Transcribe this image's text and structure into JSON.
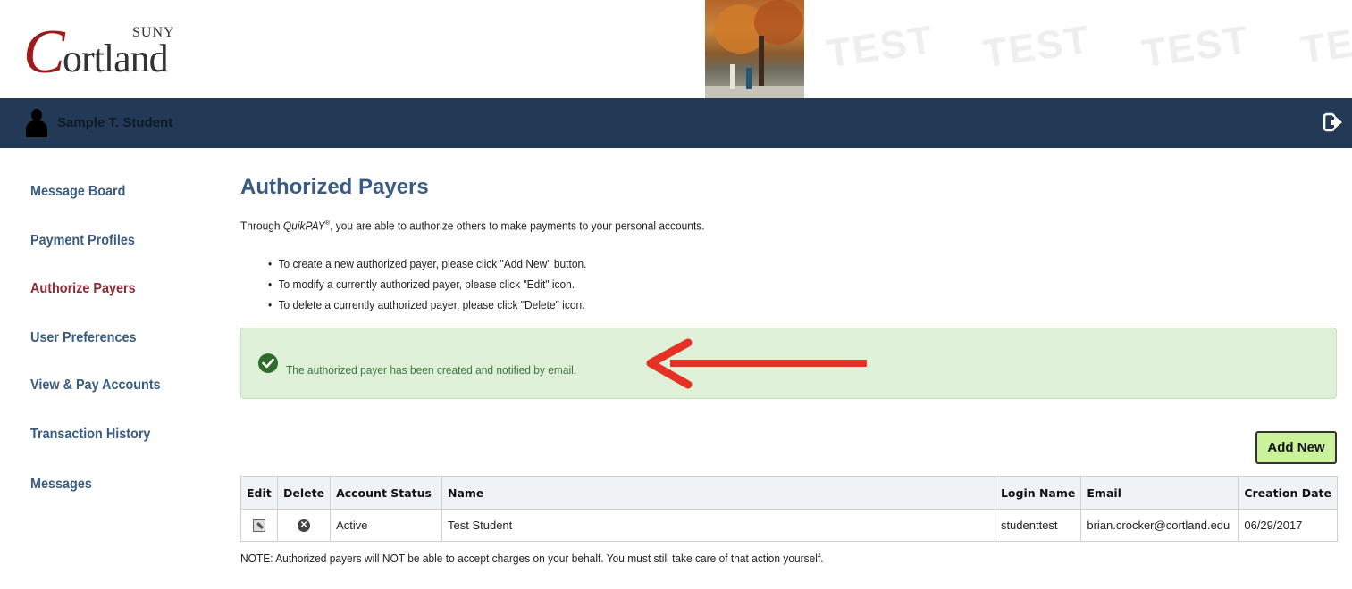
{
  "header": {
    "logo_suny": "SUNY",
    "logo_c": "C",
    "logo_ortland": "ortland",
    "watermarks": [
      "TEST",
      "TEST",
      "TEST",
      "TE"
    ]
  },
  "navbar": {
    "user_name": "Sample T. Student",
    "logout_icon": "sign-out-icon"
  },
  "sidebar": {
    "items": [
      {
        "label": "Message Board"
      },
      {
        "label": "Payment Profiles"
      },
      {
        "label": "Authorize Payers",
        "active": true
      },
      {
        "label": "User Preferences"
      },
      {
        "label": "View & Pay Accounts"
      },
      {
        "label": "Transaction History"
      },
      {
        "label": "Messages"
      }
    ]
  },
  "main": {
    "title": "Authorized Payers",
    "intro_before": "Through ",
    "intro_brand": "QuikPAY",
    "intro_mark": "®",
    "intro_after": ", you are able to authorize others to make payments to your personal accounts.",
    "bullets": [
      "To create a new authorized payer, please click \"Add New\" button.",
      "To modify a currently authorized payer, please click \"Edit\" icon.",
      "To delete a currently authorized payer, please click \"Delete\" icon."
    ],
    "alert_message": "The authorized payer has been created and notified by email.",
    "add_new_label": "Add New",
    "table": {
      "headers": [
        "Edit",
        "Delete",
        "Account Status",
        "Name",
        "Login Name",
        "Email",
        "Creation Date"
      ],
      "rows": [
        {
          "status": "Active",
          "name": "Test Student",
          "login": "studenttest",
          "email": "brian.crocker@cortland.edu",
          "created": "06/29/2017"
        }
      ]
    },
    "note": "NOTE: Authorized payers will NOT be able to accept charges on your behalf. You must still take care of that action yourself."
  },
  "colors": {
    "navbar": "#223a55",
    "link": "#3a5b83",
    "active_link": "#8f2b36",
    "alert_bg": "#dff0d8",
    "add_button": "#c9f29b",
    "annotation_arrow": "#e53224"
  }
}
